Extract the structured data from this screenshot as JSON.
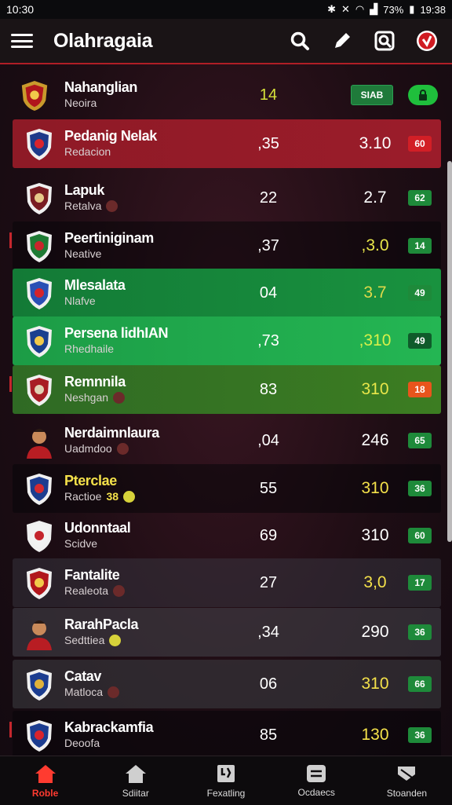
{
  "status": {
    "time_left": "10:30",
    "battery": "73%",
    "time_right": "19:38"
  },
  "app": {
    "title": "Olahragaia"
  },
  "header_row": {
    "name": "Nahanglian",
    "sub": "Neoira",
    "value": "14",
    "tag": "SIAB"
  },
  "rows": [
    {
      "name": "Pedanig Nelak",
      "sub": "Redacion",
      "v1": ",35",
      "v2": "3.10",
      "badge": "60"
    },
    {
      "name": "Lapuk",
      "sub": "Retalva",
      "v1": "22",
      "v2": "2.7",
      "badge": "62"
    },
    {
      "name": "Peertiniginam",
      "sub": "Neative",
      "v1": ",37",
      "v2": ",3.0",
      "badge": "14"
    },
    {
      "name": "Mlesalata",
      "sub": "Nlafve",
      "v1": "04",
      "v2": "3.7",
      "badge": "49"
    },
    {
      "name": "Persena lidhIAN",
      "sub": "Rhedhaile",
      "v1": ",73",
      "v2": ",310",
      "badge": "49"
    },
    {
      "name": "Remnnila",
      "sub": "Neshgan",
      "v1": "83",
      "v2": "310",
      "badge": "18"
    },
    {
      "name": "Nerdaimnlaura",
      "sub": "Uadmdoo",
      "v1": ",04",
      "v2": "246",
      "badge": "65"
    },
    {
      "name": "Pterclae",
      "sub": "Ractioe",
      "sub_extra": "38",
      "v1": "55",
      "v2": "310",
      "badge": "36"
    },
    {
      "name": "Udonntaal",
      "sub": "Scidve",
      "v1": "69",
      "v2": "310",
      "badge": "60"
    },
    {
      "name": "Fantalite",
      "sub": "Realeota",
      "v1": "27",
      "v2": "3,0",
      "badge": "17"
    },
    {
      "name": "RarahPacla",
      "sub": "Sedttiea",
      "v1": ",34",
      "v2": "290",
      "badge": "36"
    },
    {
      "name": "Catav",
      "sub": "Matloca",
      "v1": "06",
      "v2": "310",
      "badge": "66"
    },
    {
      "name": "Kabrackamfia",
      "sub": "Deoofa",
      "v1": "85",
      "v2": "130",
      "badge": "36"
    }
  ],
  "nav": [
    {
      "label": "Roble"
    },
    {
      "label": "Sdiitar"
    },
    {
      "label": "Fexatling"
    },
    {
      "label": "Ocdaecs"
    },
    {
      "label": "Stoanden"
    }
  ]
}
